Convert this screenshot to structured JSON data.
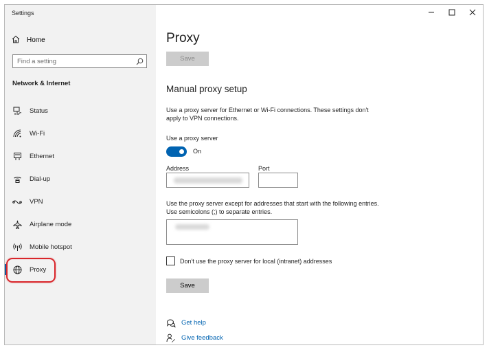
{
  "window": {
    "title": "Settings"
  },
  "sidebar": {
    "home_label": "Home",
    "search_placeholder": "Find a setting",
    "section_title": "Network & Internet",
    "items": [
      {
        "label": "Status",
        "icon": "status-icon"
      },
      {
        "label": "Wi-Fi",
        "icon": "wifi-icon"
      },
      {
        "label": "Ethernet",
        "icon": "ethernet-icon"
      },
      {
        "label": "Dial-up",
        "icon": "dialup-icon"
      },
      {
        "label": "VPN",
        "icon": "vpn-icon"
      },
      {
        "label": "Airplane mode",
        "icon": "airplane-icon"
      },
      {
        "label": "Mobile hotspot",
        "icon": "hotspot-icon"
      },
      {
        "label": "Proxy",
        "icon": "globe-icon",
        "selected": true
      }
    ]
  },
  "main": {
    "title": "Proxy",
    "save_top_label": "Save",
    "manual_title": "Manual proxy setup",
    "manual_desc": "Use a proxy server for Ethernet or Wi-Fi connections. These settings don't apply to VPN connections.",
    "use_proxy_label": "Use a proxy server",
    "toggle_state": "On",
    "address_label": "Address",
    "port_label": "Port",
    "port_value": "",
    "exceptions_desc": "Use the proxy server except for addresses that start with the following entries. Use semicolons (;) to separate entries.",
    "local_checkbox_label": "Don't use the proxy server for local (intranet) addresses",
    "local_checked": false,
    "save_label": "Save",
    "links": {
      "help": "Get help",
      "feedback": "Give feedback"
    }
  },
  "colors": {
    "accent": "#0063b1",
    "highlight_ring": "#d9262b",
    "sidebar_bg": "#f2f2f2"
  }
}
